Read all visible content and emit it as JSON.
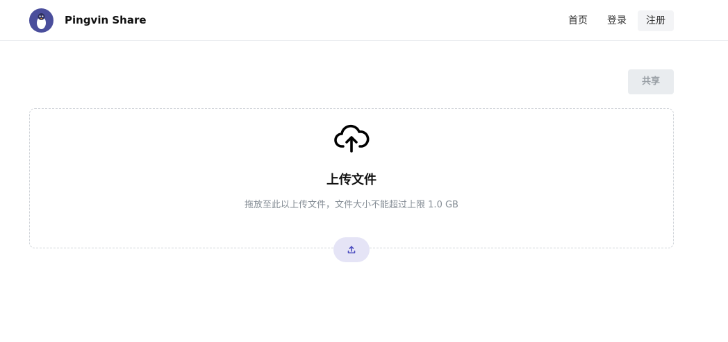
{
  "header": {
    "app_title": "Pingvin Share",
    "logo_icon": "penguin-logo-icon",
    "nav": {
      "home_label": "首页",
      "login_label": "登录",
      "register_label": "注册"
    }
  },
  "main": {
    "share_button_label": "共享",
    "dropzone": {
      "icon": "cloud-upload-icon",
      "title": "上传文件",
      "subtitle": "拖放至此以上传文件，文件大小不能超过上限 1.0 GB",
      "upload_button_icon": "upload-icon"
    }
  },
  "colors": {
    "accent": "#4c4dbf",
    "upload_button_bg": "#e5e4f6",
    "disabled_button_bg": "#e9ecef"
  }
}
